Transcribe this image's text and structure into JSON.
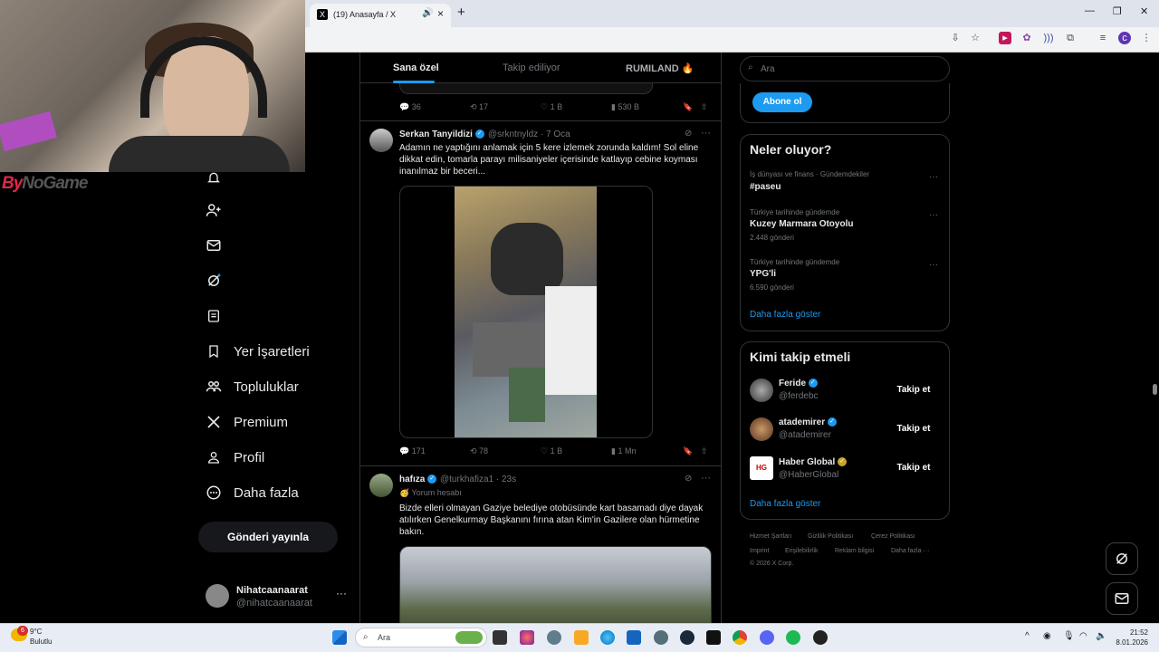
{
  "browser": {
    "tab_title": "(19) Anasayfa / X",
    "tab_favicon": "X",
    "new_tab": "+",
    "minimize": "—",
    "restore": "❐",
    "close": "✕",
    "profile_initial": "c"
  },
  "overlay": {
    "brand_red": "By",
    "brand_rest": "NoGame"
  },
  "nav": {
    "items": [
      {
        "label": "Yer İşaretleri",
        "icon": "bookmark-icon"
      },
      {
        "label": "Topluluklar",
        "icon": "communities-icon"
      },
      {
        "label": "Premium",
        "icon": "x-logo-icon"
      },
      {
        "label": "Profil",
        "icon": "profile-icon"
      },
      {
        "label": "Daha fazla",
        "icon": "more-circle-icon"
      }
    ],
    "post_button": "Gönderi yayınla",
    "account": {
      "name": "Nihatcaanaarat",
      "handle": "@nihatcaanaarat",
      "more": "···"
    }
  },
  "main": {
    "tabs": [
      {
        "label": "Sana özel",
        "active": true
      },
      {
        "label": "Takip ediliyor",
        "active": false
      },
      {
        "label": "RUMILAND 🔥",
        "active": false
      }
    ],
    "prev_actions": {
      "replies": "36",
      "reposts": "17",
      "likes": "1 B",
      "views": "530 B"
    },
    "tweet1": {
      "name": "Serkan Tanyildizi",
      "handle": "@srkntnyldz · 7 Oca",
      "text_lines": [
        "Adamın ne yaptığını anlamak için 5 kere izlemek zorunda kaldım! Sol eline",
        "dikkat edin, tomarla parayı milisaniyeler içerisinde katlayıp cebine koyması",
        "inanılmaz bir beceri..."
      ],
      "actions": {
        "replies": "171",
        "reposts": "78",
        "likes": "1 B",
        "views": "1 Mn"
      }
    },
    "tweet2": {
      "name": "hafıza",
      "handle": "@turkhafiza1 · 23s",
      "badge": "🥳 Yorum hesabı",
      "text_lines": [
        "Bizde elleri olmayan Gaziye belediye otobüsünde kart basamadı diye dayak",
        "atılırken Genelkurmay Başkanını fırına atan Kim'in Gazilere olan hürmetine",
        "bakın."
      ]
    }
  },
  "right": {
    "search_placeholder": "Ara",
    "subscribe": "Abone ol",
    "trends_title": "Neler oluyor?",
    "trends": [
      {
        "category": "İş dünyası ve finans · Gündemdekiler",
        "name": "#paseu",
        "count": ""
      },
      {
        "category": "Türkiye tarihinde gündemde",
        "name": "Kuzey Marmara Otoyolu",
        "count": "2.448 gönderi"
      },
      {
        "category": "Türkiye tarihinde gündemde",
        "name": "YPG'li",
        "count": "6.590 gönderi"
      }
    ],
    "show_more": "Daha fazla göster",
    "follow_title": "Kimi takip etmeli",
    "follow": [
      {
        "name": "Feride",
        "handle": "@ferdebc",
        "button": "Takip et"
      },
      {
        "name": "atademirer",
        "handle": "@atademirer",
        "button": "Takip et"
      },
      {
        "name": "Haber Global",
        "handle": "@HaberGlobal",
        "button": "Takip et"
      }
    ],
    "footer": [
      "Hizmet Şartları",
      "Gizlilik Politikası",
      "Çerez Politikası",
      "Imprint",
      "Erişilebilirlik",
      "Reklam bilgisi",
      "Daha fazla ···",
      "© 2026 X Corp."
    ]
  },
  "taskbar": {
    "weather_temp": "9°C",
    "weather_desc": "Bulutlu",
    "weather_badge": "6",
    "search_placeholder": "Ara",
    "time": "21:52",
    "date": "8.01.2026"
  },
  "colors": {
    "accent": "#1d9bf0",
    "background": "#000000",
    "border": "#2f3336",
    "muted": "#71767b"
  }
}
